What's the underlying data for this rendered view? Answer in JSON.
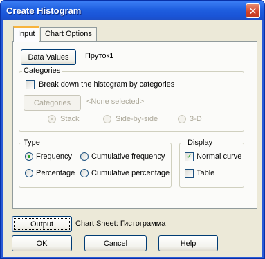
{
  "window": {
    "title": "Create Histogram",
    "close_glyph": "✕"
  },
  "tabs": [
    {
      "label": "Input",
      "active": true
    },
    {
      "label": "Chart Options",
      "active": false
    }
  ],
  "input": {
    "data_values_button": "Data Values",
    "data_values_value": "Пруток1"
  },
  "categories": {
    "group_title": "Categories",
    "break_down_label": "Break down the histogram by categories",
    "break_down_checked": false,
    "categories_button": "Categories",
    "categories_value": "<None selected>",
    "layout_options": [
      {
        "label": "Stack",
        "selected": true
      },
      {
        "label": "Side-by-side",
        "selected": false
      },
      {
        "label": "3-D",
        "selected": false
      }
    ]
  },
  "type": {
    "group_title": "Type",
    "options": [
      {
        "label": "Frequency",
        "selected": true
      },
      {
        "label": "Cumulative frequency",
        "selected": false
      },
      {
        "label": "Percentage",
        "selected": false
      },
      {
        "label": "Cumulative percentage",
        "selected": false
      }
    ]
  },
  "display": {
    "group_title": "Display",
    "normal_curve_label": "Normal curve",
    "normal_curve_checked": true,
    "table_label": "Table",
    "table_checked": false
  },
  "output": {
    "output_button": "Output",
    "output_value": "Chart Sheet: Гистограмма"
  },
  "footer": {
    "ok_label": "OK",
    "cancel_label": "Cancel",
    "help_label": "Help"
  },
  "colors": {
    "titlebar": "#1f5fe0",
    "dialog_bg": "#ece9d8",
    "check_mark": "#21a121",
    "tab_highlight": "#f7b33d"
  }
}
